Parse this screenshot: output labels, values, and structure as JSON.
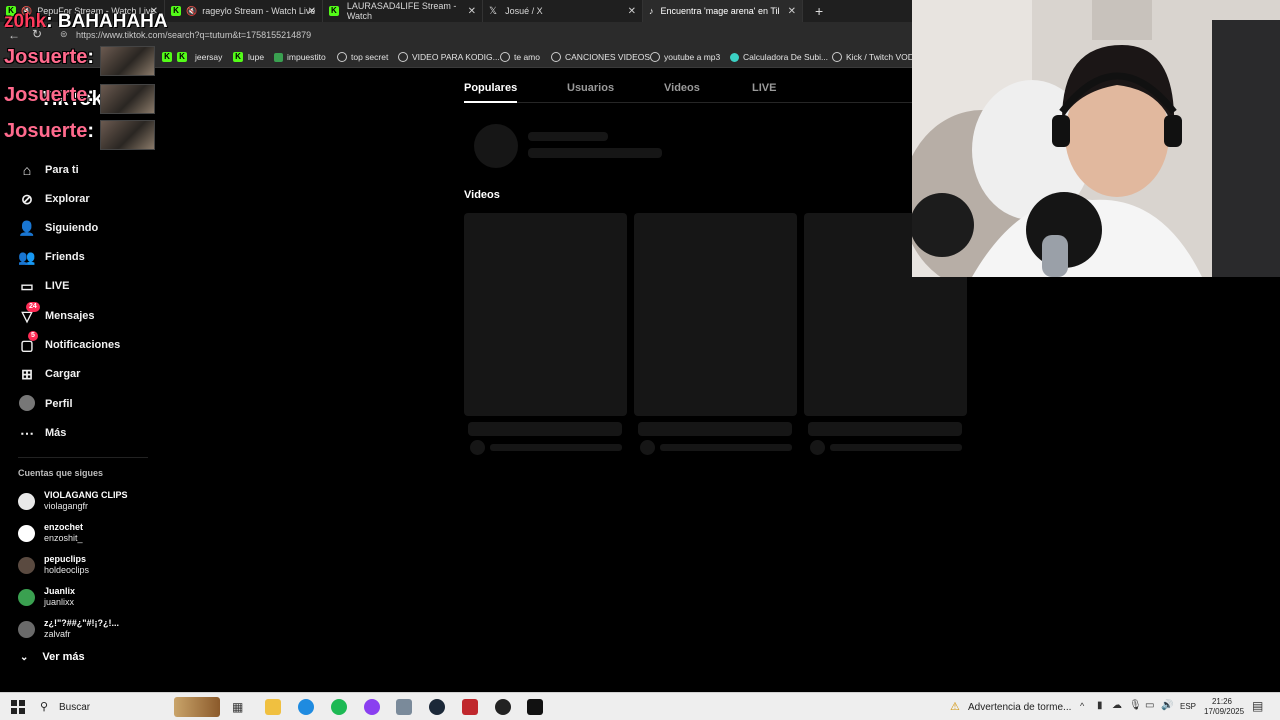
{
  "browser": {
    "tabs": [
      {
        "label": "PepuFor Stream - Watch Live",
        "active": false
      },
      {
        "label": "rageylo Stream - Watch Live",
        "active": false
      },
      {
        "label": "LAURASAD4LIFE Stream - Watch",
        "active": false
      },
      {
        "label": "Josué / X",
        "active": false
      },
      {
        "label": "Encuentra 'mage arena' en TikTok",
        "active": true
      }
    ],
    "url": "https://www.tiktok.com/search?q=tutum&t=1758155214879",
    "bookmarks": [
      {
        "label": "jeersay",
        "icon": "kick-icon"
      },
      {
        "label": "lupe",
        "icon": "kick-icon"
      },
      {
        "label": "impuestito",
        "icon": "checkbox-icon"
      },
      {
        "label": "top secret",
        "icon": "globe-icon"
      },
      {
        "label": "VIDEO PARA KODIG...",
        "icon": "globe-icon"
      },
      {
        "label": "te amo",
        "icon": "globe-icon"
      },
      {
        "label": "CANCIONES VIDEOS",
        "icon": "globe-icon"
      },
      {
        "label": "youtube a mp3",
        "icon": "globe-icon"
      },
      {
        "label": "Calculadora De Subi...",
        "icon": "dot-icon"
      },
      {
        "label": "Kick / Twitch VOD",
        "icon": "globe-icon"
      }
    ]
  },
  "overlay": {
    "top_user": "z0hk",
    "top_message": ": BAHAHAHA",
    "chat_lines": [
      {
        "user": "Josuerte",
        "sep": ":"
      },
      {
        "user": "Josuerte",
        "sep": ":"
      },
      {
        "user": "Josuerte",
        "sep": ":"
      }
    ]
  },
  "tiktok": {
    "logo": "TikTok",
    "nav": [
      {
        "label": "Para ti",
        "icon": "home-icon"
      },
      {
        "label": "Explorar",
        "icon": "compass-icon"
      },
      {
        "label": "Siguiendo",
        "icon": "following-icon"
      },
      {
        "label": "Friends",
        "icon": "friends-icon"
      },
      {
        "label": "LIVE",
        "icon": "live-icon"
      },
      {
        "label": "Mensajes",
        "icon": "messages-icon",
        "badge": "24"
      },
      {
        "label": "Notificaciones",
        "icon": "notifications-icon",
        "badge": "5"
      },
      {
        "label": "Cargar",
        "icon": "upload-icon"
      },
      {
        "label": "Perfil",
        "icon": "profile-avatar"
      },
      {
        "label": "Más",
        "icon": "more-icon"
      }
    ],
    "follows_heading": "Cuentas que sigues",
    "accounts": [
      {
        "name": "VIOLAGANG CLIPS",
        "username": "violagangfr",
        "color": "#e8e8e8"
      },
      {
        "name": "enzochet",
        "username": "enzoshit_",
        "color": "#ffffff"
      },
      {
        "name": "pepuclips",
        "username": "holdeoclips",
        "color": "#5a4a40"
      },
      {
        "name": "Juanlix",
        "username": "juanlixx",
        "color": "#3aa050"
      },
      {
        "name": "z¿!\"?##¿\"#!¡?¿!...",
        "username": "zalvafr",
        "color": "#6a6a6a"
      }
    ],
    "see_more": "Ver más",
    "search_tabs": [
      "Populares",
      "Usuarios",
      "Videos",
      "LIVE"
    ],
    "active_search_tab": "Populares",
    "videos_heading": "Videos"
  },
  "taskbar": {
    "search_label": "Buscar",
    "weather": "Advertencia de torme...",
    "lang": "ESP",
    "time": "21:26",
    "date": "17/09/2025"
  }
}
